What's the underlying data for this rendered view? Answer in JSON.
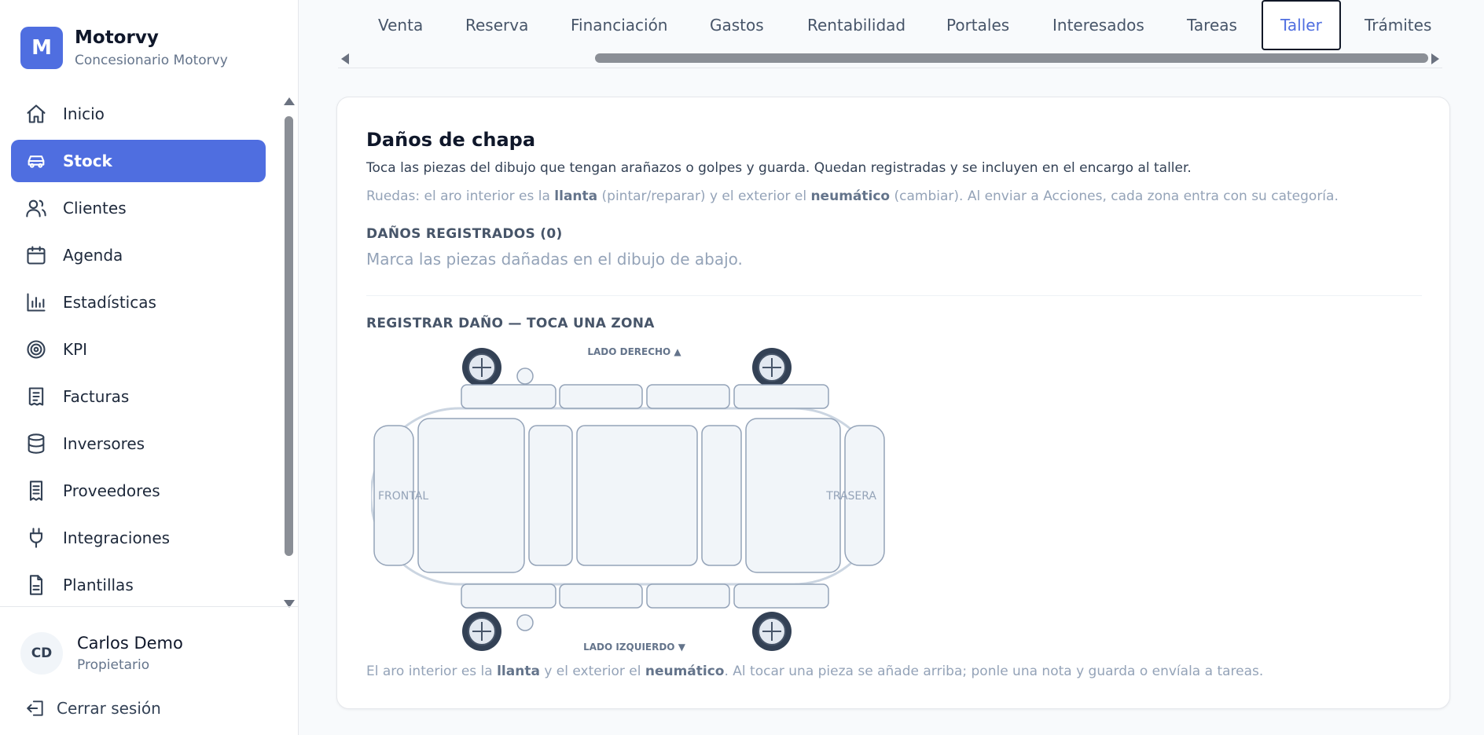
{
  "brand": {
    "initial": "M",
    "name": "Motorvy",
    "subtitle": "Concesionario Motorvy"
  },
  "sidebar": {
    "items": [
      {
        "label": "Inicio",
        "icon": "home-icon"
      },
      {
        "label": "Stock",
        "icon": "car-icon",
        "active": true
      },
      {
        "label": "Clientes",
        "icon": "users-icon"
      },
      {
        "label": "Agenda",
        "icon": "calendar-icon"
      },
      {
        "label": "Estadísticas",
        "icon": "bar-chart-icon"
      },
      {
        "label": "KPI",
        "icon": "target-icon"
      },
      {
        "label": "Facturas",
        "icon": "invoice-icon"
      },
      {
        "label": "Inversores",
        "icon": "database-icon"
      },
      {
        "label": "Proveedores",
        "icon": "receipt-icon"
      },
      {
        "label": "Integraciones",
        "icon": "plug-icon"
      },
      {
        "label": "Plantillas",
        "icon": "file-icon"
      }
    ]
  },
  "user": {
    "initials": "CD",
    "name": "Carlos Demo",
    "role": "Propietario",
    "logout_label": "Cerrar sesión"
  },
  "tabs": [
    {
      "label": "Venta"
    },
    {
      "label": "Reserva"
    },
    {
      "label": "Financiación"
    },
    {
      "label": "Gastos"
    },
    {
      "label": "Rentabilidad"
    },
    {
      "label": "Portales"
    },
    {
      "label": "Interesados"
    },
    {
      "label": "Tareas"
    },
    {
      "label": "Taller",
      "active": true
    },
    {
      "label": "Trámites"
    }
  ],
  "damage": {
    "title": "Daños de chapa",
    "description": "Toca las piezas del dibujo que tengan arañazos o golpes y guarda. Quedan registradas y se incluyen en el encargo al taller.",
    "hint_pre": "Ruedas: el aro interior es la ",
    "hint_b1": "llanta",
    "hint_mid": " (pintar/reparar) y el exterior el ",
    "hint_b2": "neumático",
    "hint_post": " (cambiar). Al enviar a Acciones, cada zona entra con su categoría.",
    "registered_title": "DAÑOS REGISTRADOS (0)",
    "registered_empty": "Marca las piezas dañadas en el dibujo de abajo.",
    "register_title": "REGISTRAR DAÑO — TOCA UNA ZONA",
    "label_right": "LADO DERECHO ▲",
    "label_left": "LADO IZQUIERDO ▼",
    "label_front": "FRONTAL",
    "label_rear": "TRASERA",
    "footer_pre": "El aro interior es la ",
    "footer_b1": "llanta",
    "footer_mid": " y el exterior el ",
    "footer_b2": "neumático",
    "footer_post": ". Al tocar una pieza se añade arriba; ponle una nota y guarda o envíala a tareas."
  },
  "colors": {
    "accent": "#4f6ee0",
    "part_fill": "#f1f5f9",
    "part_stroke": "#94a3b8",
    "wheel": "#334155"
  }
}
